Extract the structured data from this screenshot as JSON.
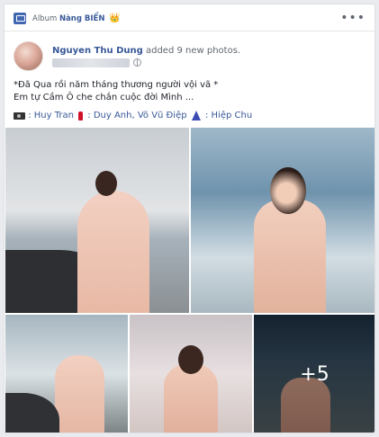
{
  "album": {
    "label": "Album",
    "name": "Nàng BIỂN",
    "crown_emoji": "👑"
  },
  "menu_dots": "•••",
  "post": {
    "author": "Nguyen Thu Dung",
    "action": "added 9 new photos.",
    "text_line1": "*Đã Qua rồi năm tháng thương người vội vã *",
    "text_line2": "Em tự Cầm Ô che chắn cuộc đời Mình ...",
    "credits": {
      "photographer": ": Huy Tran",
      "makeup": ": Duy Anh, Võ Vũ Điệp",
      "stylist": ": Hiệp Chu"
    }
  },
  "photos": {
    "more_count": "+5"
  },
  "colors": {
    "link": "#385898",
    "album_icon": "#4267b2"
  }
}
